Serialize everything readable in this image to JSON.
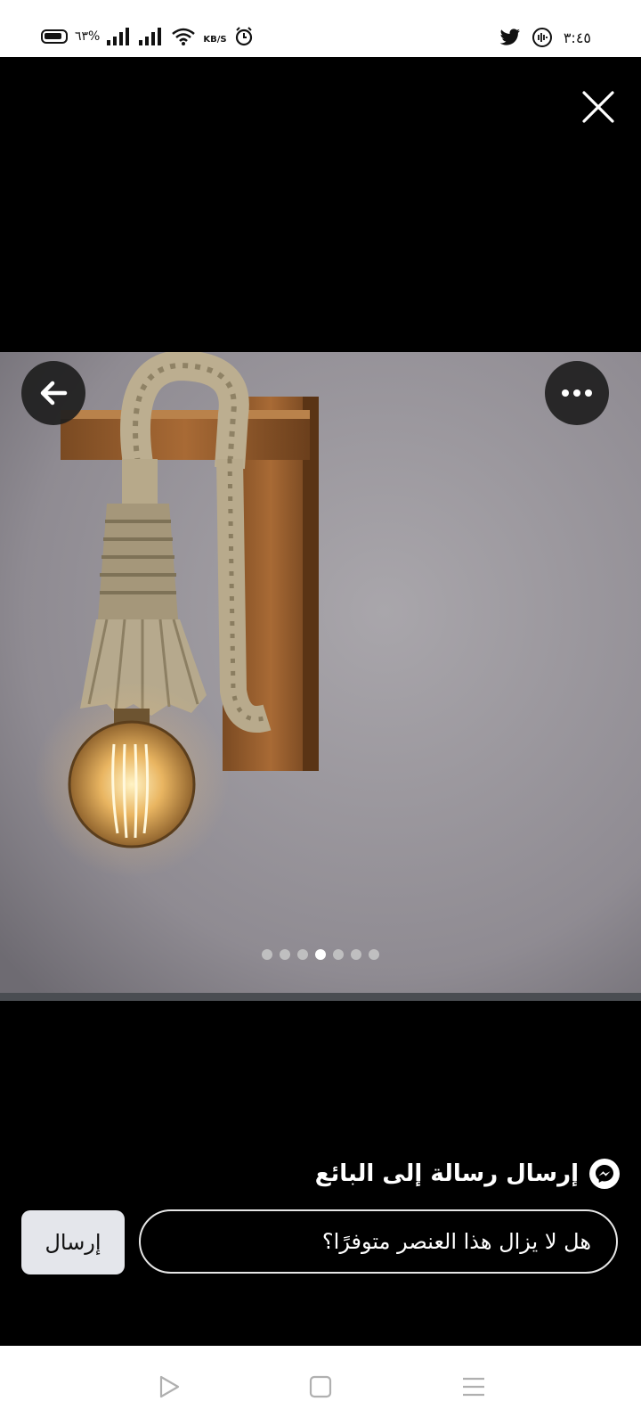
{
  "status_bar": {
    "battery_percent": "٦٣%",
    "network_speed_unit": "KB/S",
    "time": "٣:٤٥"
  },
  "viewer": {
    "close_icon": "close-icon",
    "back_icon": "arrow-left-icon",
    "more_icon": "more-horizontal-icon",
    "image_count": 7,
    "active_image_index": 3
  },
  "message": {
    "title": "إرسال رسالة إلى البائع",
    "input_value": "هل لا يزال هذا العنصر متوفرًا؟",
    "send_label": "إرسال"
  },
  "nav": {
    "icons": [
      "back-triangle-icon",
      "home-square-icon",
      "menu-lines-icon"
    ]
  },
  "colors": {
    "background": "#000000",
    "send_button": "#e4e6eb"
  }
}
